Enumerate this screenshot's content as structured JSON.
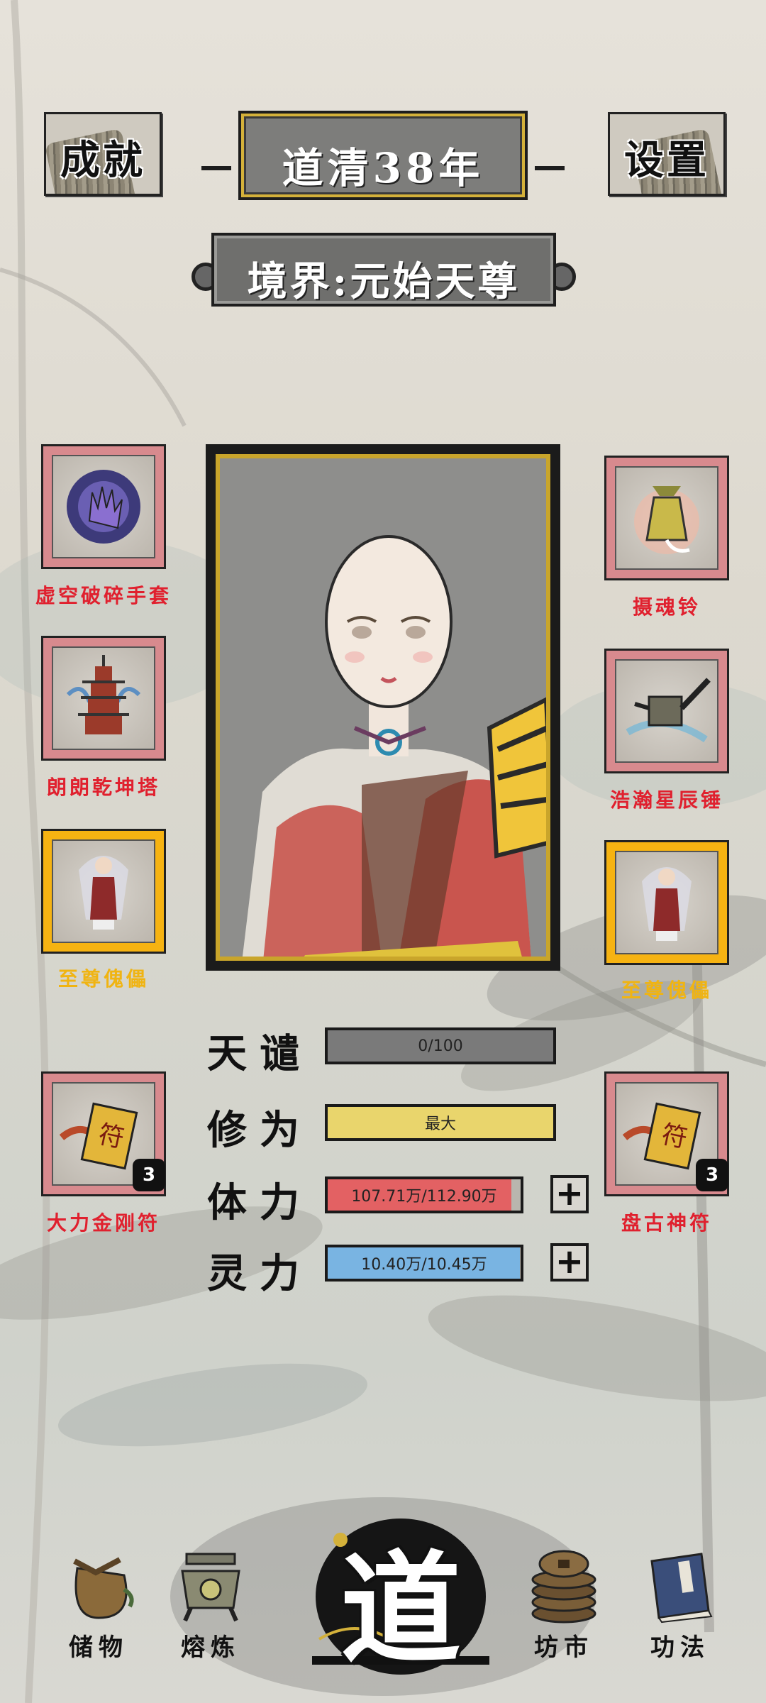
{
  "header": {
    "achievements_label": "成就",
    "settings_label": "设置",
    "year_title": "道清38年",
    "realm": "境界:元始天尊"
  },
  "equipment": {
    "left": [
      {
        "name": "虚空破碎手套",
        "rarity": "red",
        "icon": "glove-icon"
      },
      {
        "name": "朗朗乾坤塔",
        "rarity": "red",
        "icon": "pagoda-icon"
      },
      {
        "name": "至尊傀儡",
        "rarity": "gold",
        "icon": "puppet-icon"
      },
      {
        "name": "大力金刚符",
        "rarity": "red",
        "icon": "talisman-icon",
        "count": "3"
      }
    ],
    "right": [
      {
        "name": "摄魂铃",
        "rarity": "red",
        "icon": "bell-icon"
      },
      {
        "name": "浩瀚星辰锤",
        "rarity": "red",
        "icon": "hammer-icon"
      },
      {
        "name": "至尊傀儡",
        "rarity": "gold",
        "icon": "puppet-icon"
      },
      {
        "name": "盘古神符",
        "rarity": "red",
        "icon": "talisman-icon",
        "count": "3"
      }
    ]
  },
  "stats": {
    "tribulation": {
      "label": "天谴",
      "value": "0/100",
      "fraction": 0,
      "color": "#7a7a7a"
    },
    "cultivation": {
      "label": "修为",
      "value": "最大",
      "fraction": 1,
      "color": "#e9d56c"
    },
    "stamina": {
      "label": "体力",
      "value": "107.71万/112.90万",
      "fraction": 0.954,
      "color": "#e36163"
    },
    "spirit": {
      "label": "灵力",
      "value": "10.40万/10.45万",
      "fraction": 0.995,
      "color": "#79b4e2"
    }
  },
  "nav": {
    "storage": "储物",
    "smelt": "熔炼",
    "dao": "道",
    "market": "坊市",
    "skills": "功法"
  }
}
